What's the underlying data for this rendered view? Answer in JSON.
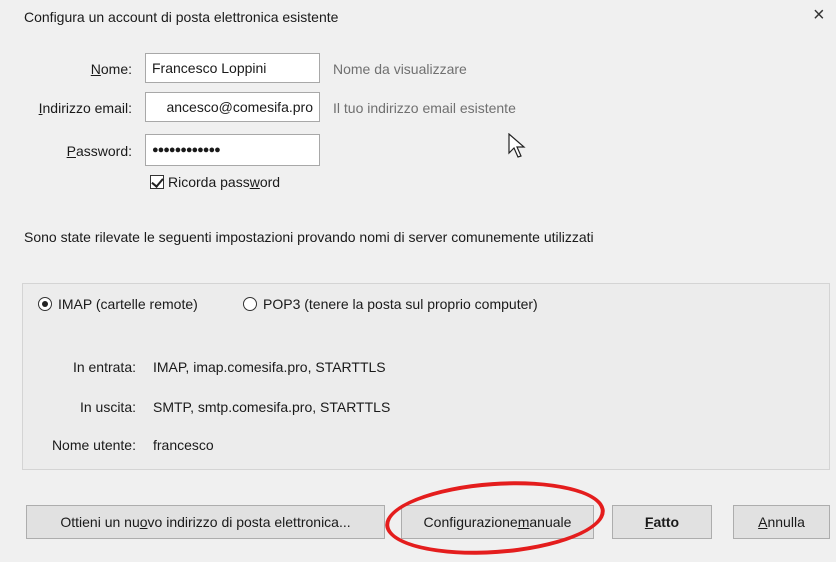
{
  "window": {
    "title": "Configura un account di posta elettronica esistente",
    "close_glyph": "×"
  },
  "form": {
    "name": {
      "label_pre": "",
      "label_ul": "N",
      "label_post": "ome:",
      "value": "Francesco Loppini",
      "hint": "Nome da visualizzare"
    },
    "email": {
      "label_pre": "",
      "label_ul": "I",
      "label_post": "ndirizzo email:",
      "value": "ancesco@comesifa.pro",
      "hint": "Il tuo indirizzo email esistente"
    },
    "password": {
      "label_pre": "",
      "label_ul": "P",
      "label_post": "assword:",
      "value": "●●●●●●●●●●●●"
    },
    "remember": {
      "label_pre": "Ricorda pass",
      "label_ul": "w",
      "label_post": "ord",
      "checked": true
    }
  },
  "detected_text": "Sono state rilevate le seguenti impostazioni provando nomi di server comunemente utilizzati",
  "protocol": {
    "imap_label": "IMAP (cartelle remote)",
    "pop3_label": "POP3 (tenere la posta sul proprio computer)",
    "selected": "IMAP"
  },
  "servers": {
    "incoming_label": "In entrata:",
    "incoming_value": "IMAP, imap.comesifa.pro, STARTTLS",
    "outgoing_label": "In uscita:",
    "outgoing_value": "SMTP, smtp.comesifa.pro, STARTTLS",
    "username_label": "Nome utente:",
    "username_value": "francesco"
  },
  "buttons": {
    "new_address": {
      "pre": "Ottieni un nu",
      "ul": "o",
      "post": "vo indirizzo di posta elettronica..."
    },
    "manual": {
      "pre": "Configurazione ",
      "ul": "m",
      "post": "anuale"
    },
    "done": {
      "pre": "",
      "ul": "F",
      "post": "atto"
    },
    "cancel": {
      "pre": "",
      "ul": "A",
      "post": "nnulla"
    }
  },
  "annotation": {
    "color": "#e41d1d",
    "shape": "ellipse-highlight"
  }
}
